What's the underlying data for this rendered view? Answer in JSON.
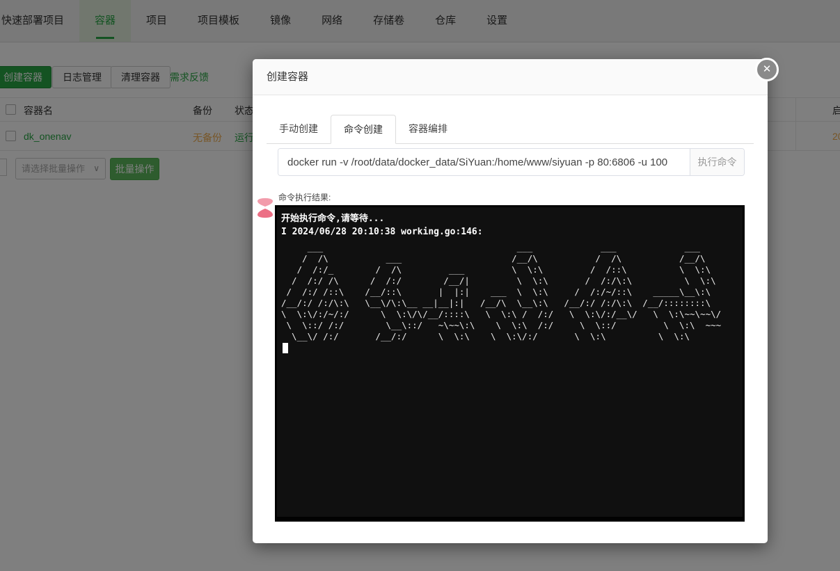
{
  "nav": {
    "items": [
      {
        "label": "快速部署项目",
        "active": false
      },
      {
        "label": "容器",
        "active": true
      },
      {
        "label": "项目",
        "active": false
      },
      {
        "label": "项目模板",
        "active": false
      },
      {
        "label": "镜像",
        "active": false
      },
      {
        "label": "网络",
        "active": false
      },
      {
        "label": "存储卷",
        "active": false
      },
      {
        "label": "仓库",
        "active": false
      },
      {
        "label": "设置",
        "active": false
      }
    ]
  },
  "toolbar": {
    "create_label": "创建容器",
    "logs_label": "日志管理",
    "clean_label": "清理容器",
    "feedback_label": "需求反馈"
  },
  "table": {
    "headers": {
      "name": "容器名",
      "backup": "备份",
      "status": "状态",
      "right_clipped": "启"
    },
    "row": {
      "name": "dk_onenav",
      "backup": "无备份",
      "status": "运行中",
      "right_clipped": "20"
    }
  },
  "batch": {
    "select_placeholder": "请选择批量操作",
    "chevron": "∨",
    "button_label": "批量操作"
  },
  "modal": {
    "title": "创建容器",
    "close_glyph": "✕",
    "tabs": [
      {
        "label": "手动创建",
        "active": false
      },
      {
        "label": "命令创建",
        "active": true
      },
      {
        "label": "容器编排",
        "active": false
      }
    ],
    "command_value": "docker run -v /root/data/docker_data/SiYuan:/home/www/siyuan -p 80:6806 -u 100",
    "run_button_label": "执行命令",
    "result_label": "命令执行结果:"
  },
  "terminal": {
    "head_lines": [
      "开始执行命令,请等待...",
      "I 2024/06/28 20:10:38 working.go:146:"
    ],
    "banner_lines": [
      "     ___                                     ___             ___             ___",
      "    /  /\\           ___                     /__/\\           /  /\\           /__/\\",
      "   /  /:/_        /  /\\         ___         \\  \\:\\         /  /::\\          \\  \\:\\",
      "  /  /:/ /\\      /  /:/        /__/|         \\  \\:\\       /  /:/\\:\\          \\  \\:\\",
      " /  /:/ /::\\    /__/::\\       |  |:|    ___  \\  \\:\\     /  /:/~/::\\    _____\\__\\:\\",
      "/__/:/ /:/\\:\\   \\__\\/\\:\\__ __|__|:|   /__/\\  \\__\\:\\   /__/:/ /:/\\:\\  /__/::::::::\\",
      "\\  \\:\\/:/~/:/      \\  \\:\\/\\/__/::::\\   \\  \\:\\ /  /:/   \\  \\:\\/:/__\\/   \\  \\:\\~~\\~~\\/",
      " \\  \\::/ /:/        \\__\\::/   ~\\~~\\:\\    \\  \\:\\  /:/     \\  \\::/         \\  \\:\\  ~~~",
      "  \\__\\/ /:/       /__/:/      \\  \\:\\    \\  \\:\\/:/       \\  \\:\\          \\  \\:\\"
    ]
  },
  "colors": {
    "accent_green": "#28a745",
    "batch_green": "#5cb85c",
    "warn_orange": "#f0ad4e",
    "terminal_bg": "#101010",
    "loading_pink": "#ef8098",
    "overlay": "rgba(0,0,0,0.5)"
  }
}
